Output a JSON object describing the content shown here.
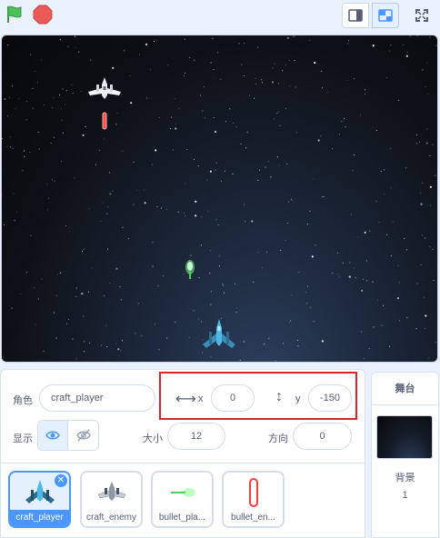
{
  "toolbar": {
    "green_flag_icon": "green-flag-icon",
    "stop_icon": "stop-icon",
    "layout_buttons": [
      "small-stage-icon",
      "large-stage-icon",
      "fullscreen-icon"
    ]
  },
  "sprite_info": {
    "sprite_label": "角色",
    "sprite_name": "craft_player",
    "x_label": "x",
    "x_value": "0",
    "y_label": "y",
    "y_value": "-150",
    "show_label": "显示",
    "size_label": "大小",
    "size_value": "12",
    "direction_label": "方向",
    "direction_value": "0"
  },
  "sprites": [
    {
      "name": "craft_player",
      "selected": true
    },
    {
      "name": "craft_enemy",
      "selected": false
    },
    {
      "name": "bullet_pla...",
      "selected": false
    },
    {
      "name": "bullet_en...",
      "selected": false
    }
  ],
  "stage_panel": {
    "title": "舞台",
    "backdrop_label": "背景",
    "backdrop_count": "1"
  },
  "colors": {
    "accent": "#4c97ff",
    "highlight": "#d7262d",
    "flag": "#4cbf56",
    "stop": "#ec5959"
  }
}
